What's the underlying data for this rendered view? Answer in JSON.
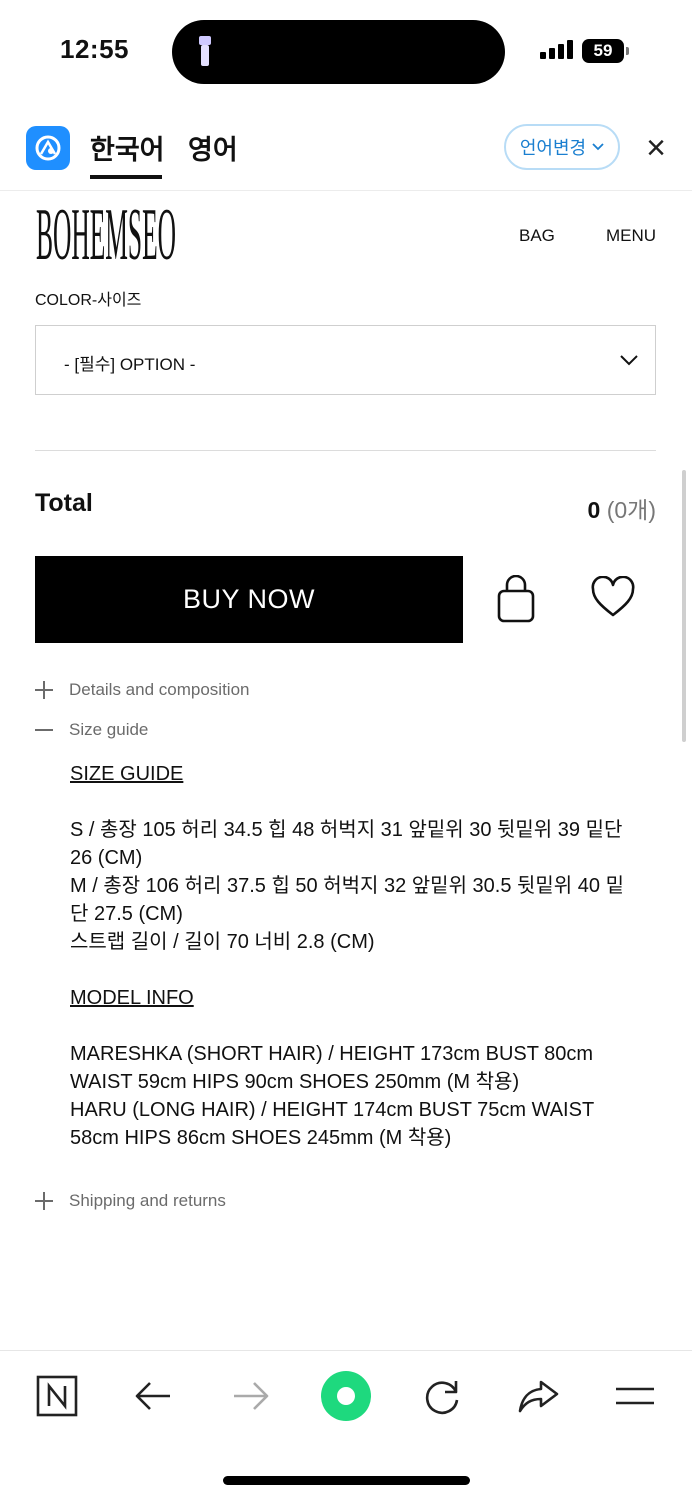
{
  "status_bar": {
    "time": "12:55",
    "battery": "59"
  },
  "translate_bar": {
    "lang_tabs": [
      "한국어",
      "영어"
    ],
    "change_button": "언어변경"
  },
  "site": {
    "logo": "BOHEMSEO",
    "nav": {
      "bag": "BAG",
      "menu": "MENU"
    }
  },
  "product": {
    "option_label": "COLOR-사이즈",
    "option_select": "- [필수] OPTION -",
    "total_label": "Total",
    "total_value": "0",
    "total_count": "(0개)",
    "buy_now": "BUY NOW"
  },
  "accordion": {
    "details": "Details and composition",
    "size_guide": "Size guide",
    "shipping": "Shipping and returns"
  },
  "size_guide": {
    "heading": "SIZE GUIDE",
    "lines": [
      "S / 총장 105 허리 34.5 힙 48 허벅지 31 앞밑위 30 뒷밑위 39 밑단 26 (CM)",
      "M / 총장 106 허리 37.5 힙 50 허벅지 32 앞밑위 30.5 뒷밑위 40 밑단 27.5 (CM)",
      "스트랩 길이 / 길이 70 너비 2.8 (CM)"
    ],
    "model_heading": "MODEL INFO",
    "model_lines": [
      "MARESHKA (SHORT HAIR) / HEIGHT 173cm BUST 80cm WAIST 59cm HIPS 90cm SHOES 250mm (M 착용)",
      "HARU (LONG HAIR) / HEIGHT 174cm BUST 75cm WAIST 58cm HIPS 86cm SHOES 245mm (M 착용)"
    ]
  },
  "colors": {
    "accent_blue": "#1f8fff",
    "browser_green": "#1ed97e"
  },
  "toolbar_icons": [
    "naver-n-icon",
    "back-arrow-icon",
    "forward-arrow-icon",
    "green-dot-icon",
    "reload-icon",
    "share-icon",
    "hamburger-menu-icon"
  ]
}
